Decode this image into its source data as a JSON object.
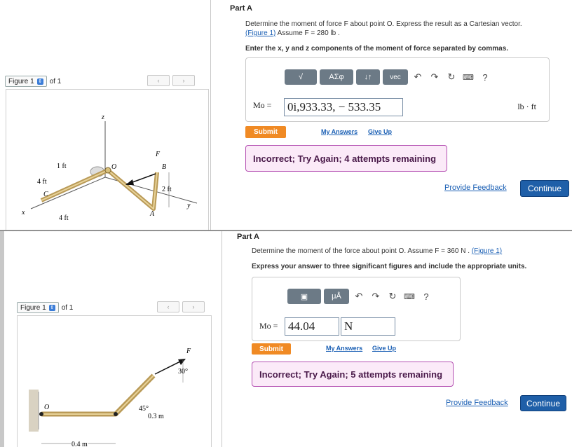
{
  "top": {
    "figure_select": "Figure 1",
    "figure_of": "of 1",
    "part_title": "Part A",
    "question_line1": "Determine the moment of force F about point O. Express the result as a Cartesian vector.",
    "figure_link": "(Figure 1)",
    "assume": "Assume F = 280 lb .",
    "instruction": "Enter the x, y and z components of the moment of force separated by commas.",
    "toolbar": [
      "√",
      "ΑΣφ",
      "↓↑",
      "vec"
    ],
    "input_label": "Mo =",
    "input_value": "0i,933.33, − 533.35",
    "unit": "lb · ft",
    "submit": "Submit",
    "my_answers": "My Answers",
    "give_up": "Give Up",
    "alert": "Incorrect; Try Again; 4 attempts remaining",
    "provide_feedback": "Provide Feedback",
    "continue": "Continue",
    "fig_labels": {
      "z": "z",
      "F": "F",
      "B": "B",
      "O": "O",
      "ft1": "1 ft",
      "ft4a": "4 ft",
      "C": "C",
      "ft2": "2 ft",
      "A": "A",
      "x": "x",
      "y": "y",
      "ft4b": "4 ft"
    }
  },
  "bottom": {
    "figure_select": "Figure 1",
    "figure_of": "of 1",
    "part_title": "Part A",
    "question": "Determine the moment of the force about point O. Assume F = 360 N .",
    "figure_link": "(Figure 1)",
    "instruction": "Express your answer to three significant figures and include the appropriate units.",
    "toolbar": [
      "▣",
      "μÅ"
    ],
    "input_label": "Mo =",
    "input_value": "44.04",
    "unit_value": "N",
    "submit": "Submit",
    "my_answers": "My Answers",
    "give_up": "Give Up",
    "alert": "Incorrect; Try Again; 5 attempts remaining",
    "provide_feedback": "Provide Feedback",
    "continue": "Continue",
    "fig_labels": {
      "F": "F",
      "angle30": "30°",
      "O": "O",
      "angle45": "45°",
      "len03": "0.3 m",
      "len04": "0.4 m"
    }
  }
}
